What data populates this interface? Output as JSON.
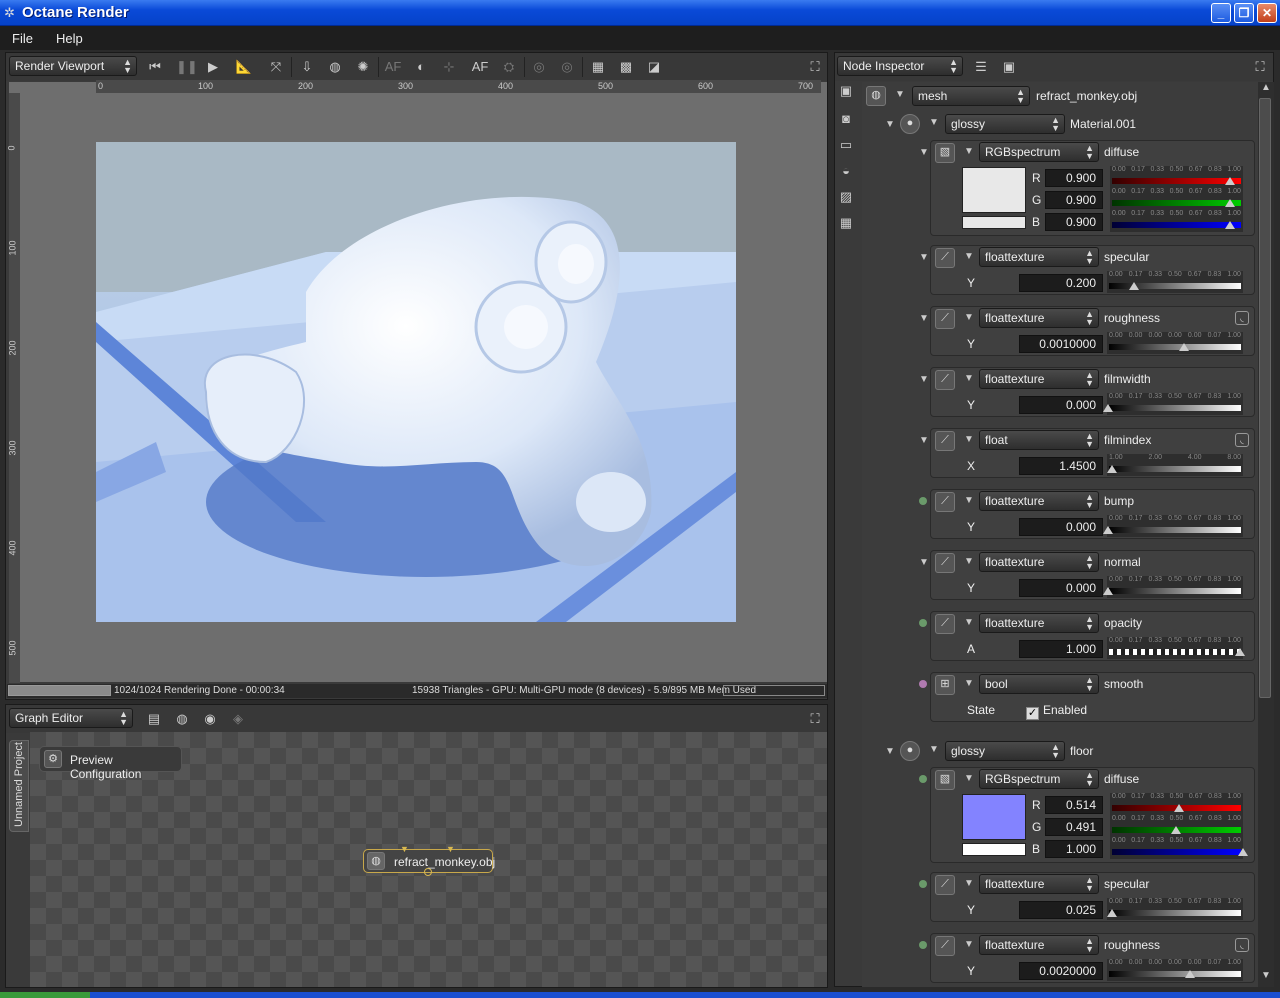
{
  "window": {
    "title": "Octane Render"
  },
  "menu": [
    "File",
    "Help"
  ],
  "viewport": {
    "selector": "Render Viewport",
    "af_label": "AF",
    "ruler_h": [
      "0",
      "100",
      "200",
      "300",
      "400",
      "500",
      "600",
      "700"
    ],
    "ruler_v": [
      "0",
      "100",
      "200",
      "300",
      "400",
      "500"
    ],
    "status_left": "1024/1024 Rendering Done - 00:00:34",
    "status_right": "15938 Triangles - GPU: Multi-GPU mode (8 devices) - 5.9/895 MB Mem Used",
    "progress": 1.0
  },
  "graph": {
    "selector": "Graph Editor",
    "side_tab": "Unnamed Project",
    "nodes": {
      "preview": "Preview Configuration",
      "mesh": "refract_monkey.obj"
    }
  },
  "inspector": {
    "selector": "Node Inspector",
    "mesh": {
      "type": "mesh",
      "name": "refract_monkey.obj"
    },
    "material1": {
      "type": "glossy",
      "name": "Material.001"
    },
    "material2": {
      "type": "glossy",
      "name": "floor"
    },
    "tick_labels": [
      "0.00",
      "0.17",
      "0.33",
      "0.50",
      "0.67",
      "0.83",
      "1.00"
    ],
    "rough_ticks": [
      "0.00",
      "0.00",
      "0.00",
      "0.00",
      "0.00",
      "0.07",
      "1.00"
    ],
    "index_ticks": [
      "1.00",
      "2.00",
      "4.00",
      "8.00"
    ],
    "m1": {
      "diffuse": {
        "type": "RGBspectrum",
        "name": "diffuse",
        "R": "0.900",
        "G": "0.900",
        "B": "0.900",
        "swatch": "#e8e8e8"
      },
      "specular": {
        "type": "floattexture",
        "name": "specular",
        "ch": "Y",
        "value": "0.200"
      },
      "roughness": {
        "type": "floattexture",
        "name": "roughness",
        "ch": "Y",
        "value": "0.0010000"
      },
      "filmwidth": {
        "type": "floattexture",
        "name": "filmwidth",
        "ch": "Y",
        "value": "0.000"
      },
      "filmindex": {
        "type": "float",
        "name": "filmindex",
        "ch": "X",
        "value": "1.4500"
      },
      "bump": {
        "type": "floattexture",
        "name": "bump",
        "ch": "Y",
        "value": "0.000"
      },
      "normal": {
        "type": "floattexture",
        "name": "normal",
        "ch": "Y",
        "value": "0.000"
      },
      "opacity": {
        "type": "floattexture",
        "name": "opacity",
        "ch": "A",
        "value": "1.000"
      },
      "smooth": {
        "type": "bool",
        "name": "smooth",
        "ch": "State",
        "value": "Enabled"
      }
    },
    "m2": {
      "diffuse": {
        "type": "RGBspectrum",
        "name": "diffuse",
        "R": "0.514",
        "G": "0.491",
        "B": "1.000",
        "swatch": "#8383ff"
      },
      "specular": {
        "type": "floattexture",
        "name": "specular",
        "ch": "Y",
        "value": "0.025"
      },
      "roughness": {
        "type": "floattexture",
        "name": "roughness",
        "ch": "Y",
        "value": "0.0020000"
      }
    }
  }
}
